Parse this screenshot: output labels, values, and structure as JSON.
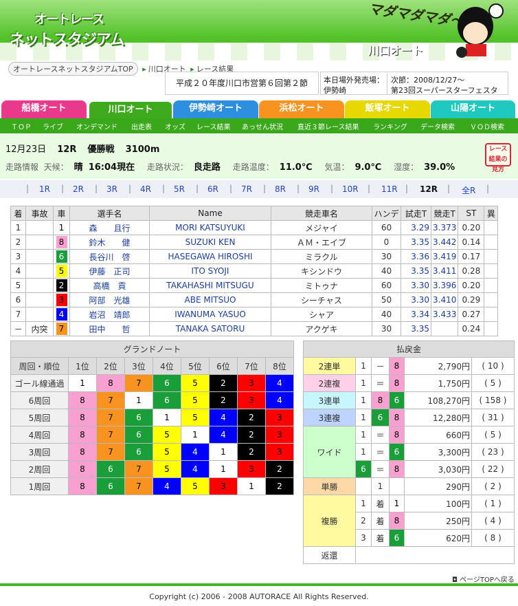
{
  "header": {
    "logo_line1": "オートレース",
    "logo_line2": "ネットスタジアム",
    "tagline": "マダマダマダ〜",
    "venue": "川口オート"
  },
  "breadcrumb": {
    "home": "オートレースネットスタジアムTOP",
    "venue": "川口オート",
    "page": "レース結果"
  },
  "meet_title": "平成２０年度川口市営第６回第２節",
  "schedule": {
    "label1": "本日場外発売場：",
    "label2": "伊勢崎",
    "next_label": "次節：2008/12/27〜",
    "next_event": "第23回スーパースターフェスタ"
  },
  "venue_tabs": [
    "船橋オート",
    "川口オート",
    "伊勢崎オート",
    "浜松オート",
    "飯塚オート",
    "山陽オート"
  ],
  "sub_nav": [
    "ＴＯＰ",
    "ライブ",
    "オンデマンド",
    "出走表",
    "オッズ",
    "レース結果",
    "あっせん状況",
    "直近３節レース結果",
    "ランキング",
    "データ検索",
    "ＶＯＤ検索"
  ],
  "race": {
    "date": "12月23日",
    "race_no": "12R",
    "grade": "優勝戦",
    "distance": "3100m",
    "track_info_label": "走路情報",
    "weather_label": "天候：",
    "weather": "晴",
    "time": "16:04現在",
    "cond_label": "走路状況：",
    "cond": "良走路",
    "temp_label": "走路温度：",
    "temp": "11.0℃",
    "air_label": "気温：",
    "air": "9.0℃",
    "hum_label": "湿度：",
    "hum": "39.0%",
    "howto": "レース結果の見方"
  },
  "race_nav": [
    "1R",
    "2R",
    "3R",
    "4R",
    "5R",
    "6R",
    "7R",
    "8R",
    "9R",
    "10R",
    "11R",
    "12R",
    "全R"
  ],
  "results": {
    "headers": [
      "着",
      "事故",
      "車",
      "選手名",
      "Name",
      "競走車名",
      "ハンデ",
      "試走T",
      "競走T",
      "ST",
      "異"
    ],
    "rows": [
      {
        "pos": "1",
        "acc": "",
        "car": "1",
        "name": "森　　且行",
        "en": "MORI KATSUYUKI",
        "bike": "メジャイ",
        "h": "60",
        "t1": "3.29",
        "t2": "3.373",
        "st": "0.20"
      },
      {
        "pos": "2",
        "acc": "",
        "car": "8",
        "name": "鈴木　　健",
        "en": "SUZUKI KEN",
        "bike": "ＡＭ・エイブ",
        "h": "0",
        "t1": "3.35",
        "t2": "3.442",
        "st": "0.14"
      },
      {
        "pos": "3",
        "acc": "",
        "car": "6",
        "name": "長谷川　啓",
        "en": "HASEGAWA HIROSHI",
        "bike": "ミラクル",
        "h": "30",
        "t1": "3.36",
        "t2": "3.419",
        "st": "0.17"
      },
      {
        "pos": "4",
        "acc": "",
        "car": "5",
        "name": "伊藤　正司",
        "en": "ITO SYOJI",
        "bike": "キシンドウ",
        "h": "40",
        "t1": "3.35",
        "t2": "3.411",
        "st": "0.28"
      },
      {
        "pos": "5",
        "acc": "",
        "car": "2",
        "name": "高橋　貢",
        "en": "TAKAHASHI MITSUGU",
        "bike": "ミトゥナ",
        "h": "60",
        "t1": "3.30",
        "t2": "3.396",
        "st": "0.20"
      },
      {
        "pos": "6",
        "acc": "",
        "car": "3",
        "name": "阿部　光雄",
        "en": "ABE MITSUO",
        "bike": "シーチャス",
        "h": "50",
        "t1": "3.30",
        "t2": "3.410",
        "st": "0.29"
      },
      {
        "pos": "7",
        "acc": "",
        "car": "4",
        "name": "岩沼　靖郎",
        "en": "IWANUMA YASUO",
        "bike": "シャア",
        "h": "40",
        "t1": "3.34",
        "t2": "3.433",
        "st": "0.27"
      },
      {
        "pos": "－",
        "acc": "内突",
        "car": "7",
        "name": "田中　　哲",
        "en": "TANAKA SATORU",
        "bike": "アクゲキ",
        "h": "30",
        "t1": "3.35",
        "t2": "",
        "st": "0.24"
      }
    ]
  },
  "grand": {
    "title": "グランドノート",
    "corner": "周回・順位",
    "cols": [
      "1位",
      "2位",
      "3位",
      "4位",
      "5位",
      "6位",
      "7位",
      "8位"
    ],
    "rows": [
      {
        "label": "ゴール線通過",
        "cars": [
          "1",
          "8",
          "7",
          "6",
          "5",
          "2",
          "3",
          "4"
        ]
      },
      {
        "label": "6周回",
        "cars": [
          "8",
          "7",
          "1",
          "6",
          "5",
          "2",
          "3",
          "4"
        ]
      },
      {
        "label": "5周回",
        "cars": [
          "8",
          "7",
          "6",
          "1",
          "5",
          "4",
          "2",
          "3"
        ]
      },
      {
        "label": "4周回",
        "cars": [
          "8",
          "7",
          "6",
          "5",
          "1",
          "4",
          "2",
          "3"
        ]
      },
      {
        "label": "3周回",
        "cars": [
          "8",
          "7",
          "6",
          "5",
          "4",
          "1",
          "2",
          "3"
        ]
      },
      {
        "label": "2周回",
        "cars": [
          "8",
          "6",
          "7",
          "5",
          "4",
          "1",
          "3",
          "2"
        ]
      },
      {
        "label": "1周回",
        "cars": [
          "8",
          "6",
          "7",
          "4",
          "5",
          "3",
          "1",
          "2"
        ]
      }
    ]
  },
  "payout": {
    "title": "払戻金",
    "yen": "円",
    "rows": [
      {
        "type": "2連単",
        "a": "1",
        "sep": "－",
        "b": "8",
        "c": "",
        "amt": "2,790",
        "pop": "( 10 )"
      },
      {
        "type": "2連複",
        "a": "1",
        "sep": "＝",
        "b": "8",
        "c": "",
        "amt": "1,750",
        "pop": "( 5 )"
      },
      {
        "type": "3連単",
        "a": "1",
        "sep": "8",
        "b": "6",
        "c": "",
        "amt": "108,270",
        "pop": "( 158 )"
      },
      {
        "type": "3連複",
        "a": "1",
        "sep": "6",
        "b": "8",
        "c": "",
        "amt": "12,280",
        "pop": "( 31 )"
      },
      {
        "type": "ワイド",
        "a": "1",
        "sep": "＝",
        "b": "8",
        "c": "",
        "amt": "660",
        "pop": "( 5 )"
      },
      {
        "type": "",
        "a": "1",
        "sep": "＝",
        "b": "6",
        "c": "",
        "amt": "3,300",
        "pop": "( 23 )"
      },
      {
        "type": "",
        "a": "6",
        "sep": "＝",
        "b": "8",
        "c": "",
        "amt": "3,030",
        "pop": "( 22 )"
      },
      {
        "type": "単勝",
        "a": "",
        "sep": "1",
        "b": "",
        "c": "",
        "amt": "290",
        "pop": "( 2 )"
      },
      {
        "type": "複勝",
        "a": "1",
        "sep": "着",
        "b": "1",
        "c": "",
        "amt": "100",
        "pop": "( 1 )"
      },
      {
        "type": "",
        "a": "2",
        "sep": "着",
        "b": "8",
        "c": "",
        "amt": "250",
        "pop": "( 4 )"
      },
      {
        "type": "",
        "a": "3",
        "sep": "着",
        "b": "6",
        "c": "",
        "amt": "620",
        "pop": "( 8 )"
      },
      {
        "type": "返還",
        "a": "",
        "sep": "",
        "b": "",
        "c": "",
        "amt": "",
        "pop": ""
      }
    ]
  },
  "page_top": "ページTOPへ戻る",
  "footer": "Copyright (c) 2006 - 2008 AUTORACE All Rights Reserved."
}
